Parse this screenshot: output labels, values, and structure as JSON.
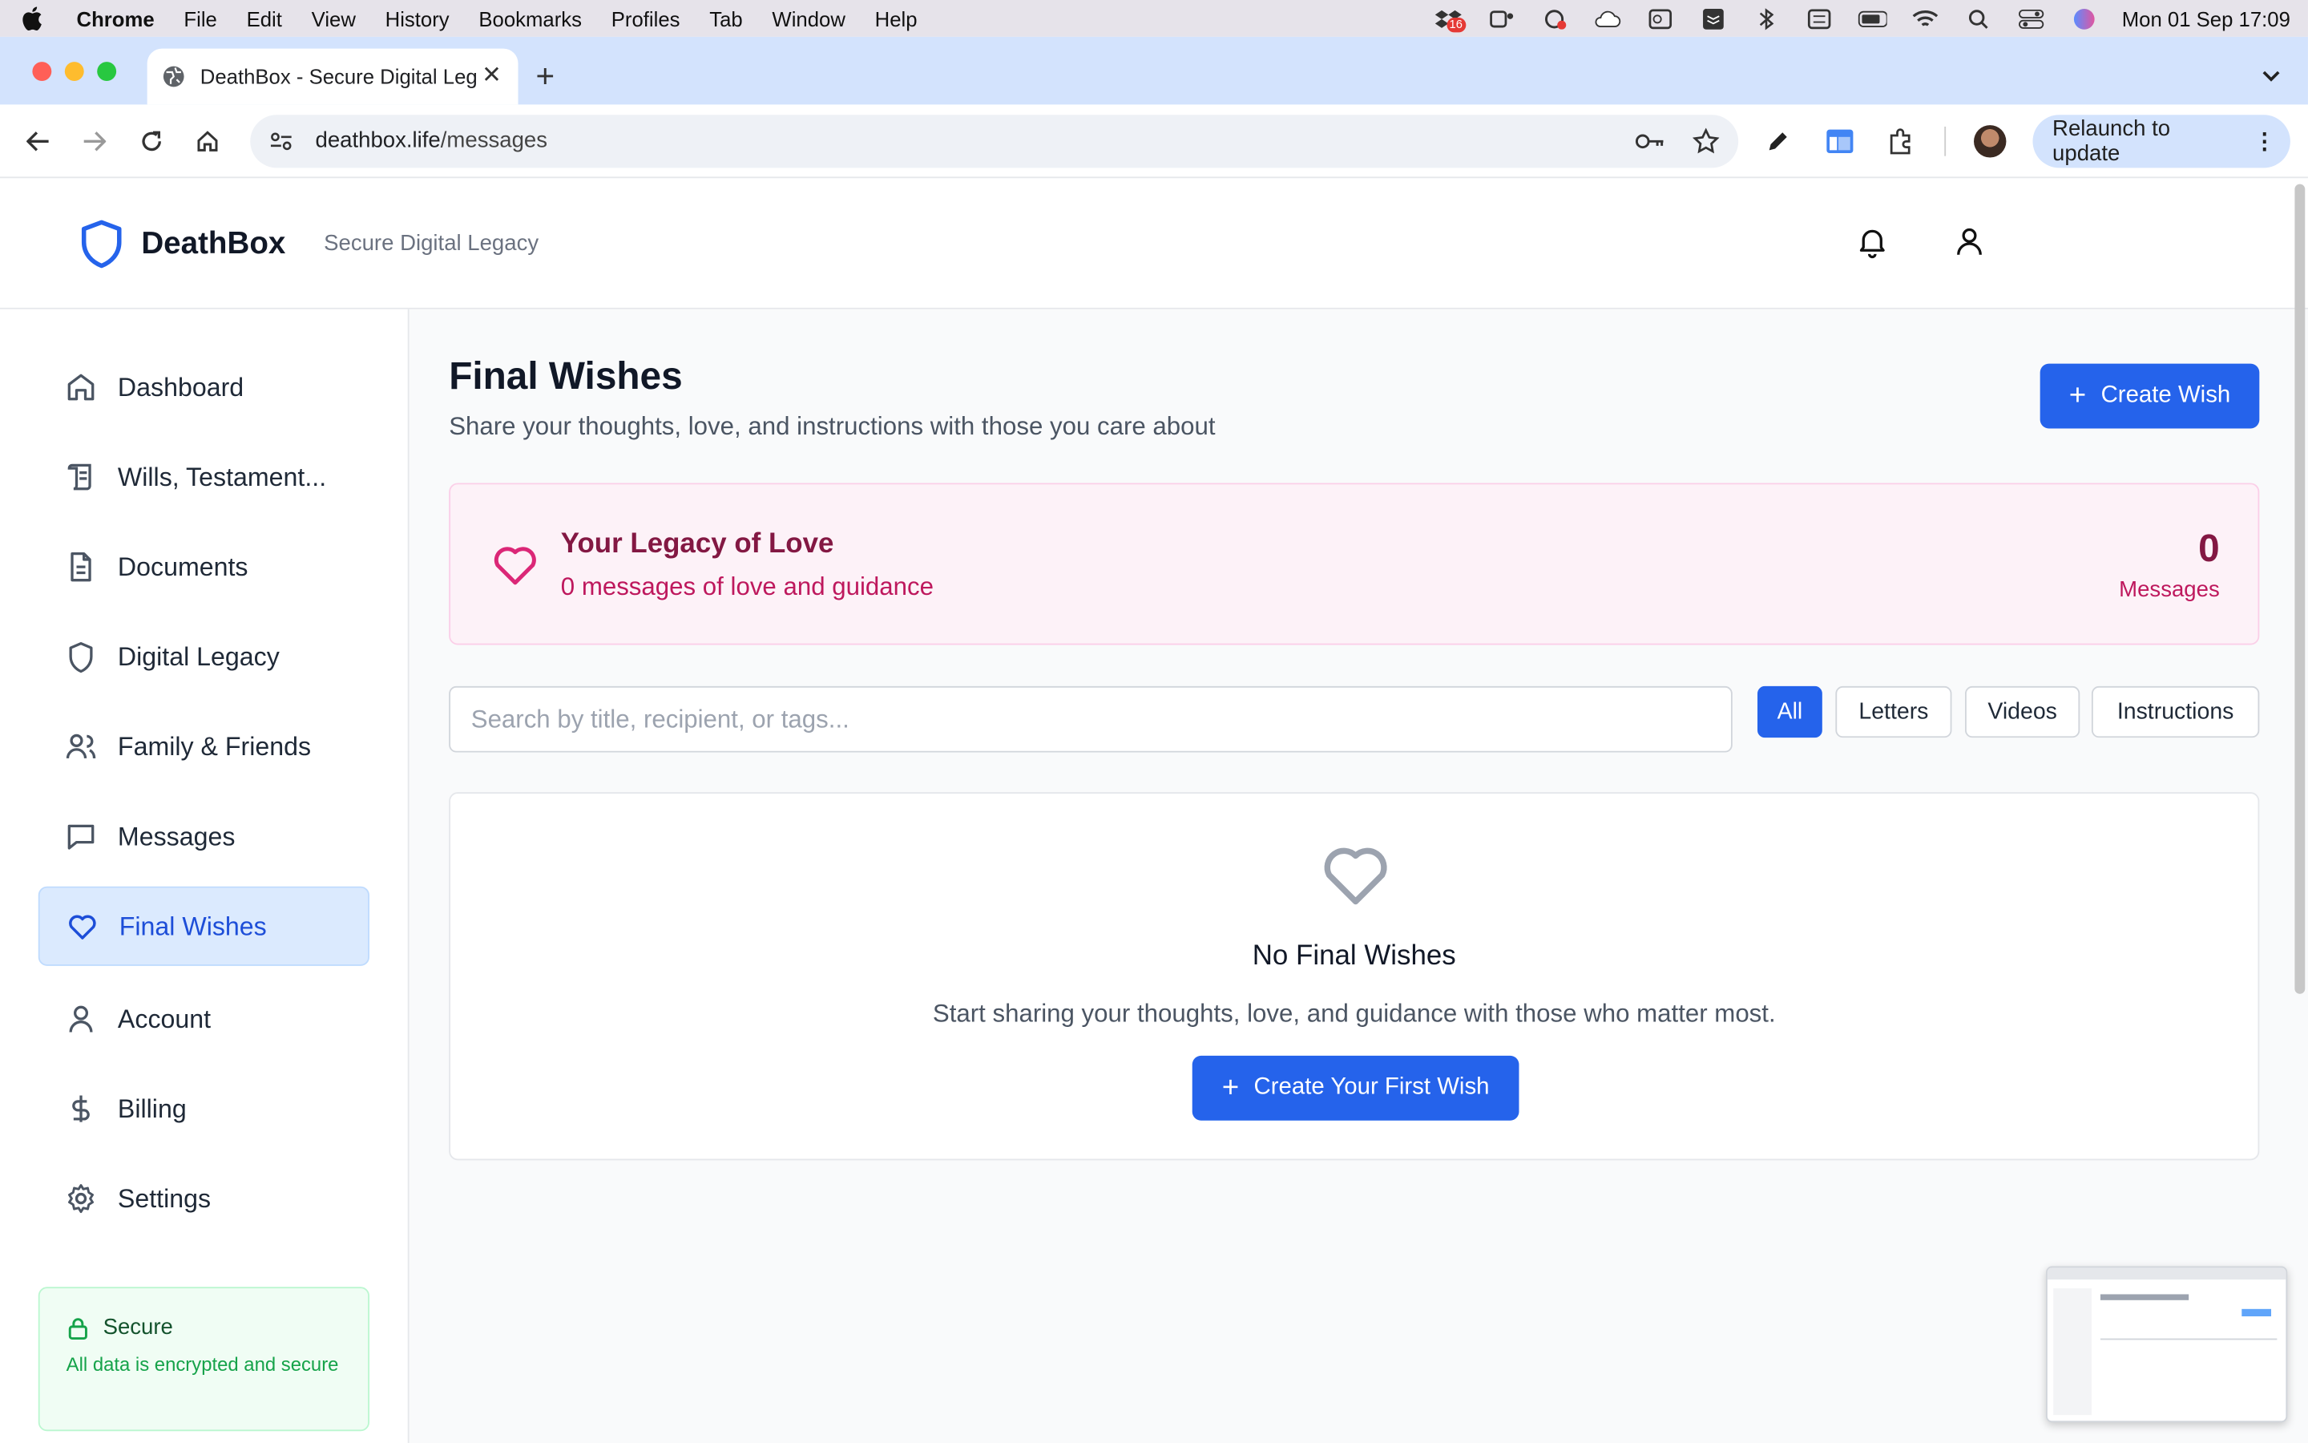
{
  "menubar": {
    "app": "Chrome",
    "items": [
      "File",
      "Edit",
      "View",
      "History",
      "Bookmarks",
      "Profiles",
      "Tab",
      "Window",
      "Help"
    ],
    "datetime": "Mon 01 Sep  17:09",
    "badge": "16"
  },
  "browser": {
    "tab_title": "DeathBox - Secure Digital Leg",
    "url_host": "deathbox.life",
    "url_path": "/messages",
    "relaunch_label": "Relaunch to update"
  },
  "header": {
    "brand": "DeathBox",
    "tagline": "Secure Digital Legacy"
  },
  "sidebar": {
    "items": [
      {
        "label": "Dashboard",
        "icon": "home-icon"
      },
      {
        "label": "Wills, Testament...",
        "icon": "scroll-icon"
      },
      {
        "label": "Documents",
        "icon": "file-icon"
      },
      {
        "label": "Digital Legacy",
        "icon": "shield-icon"
      },
      {
        "label": "Family & Friends",
        "icon": "users-icon"
      },
      {
        "label": "Messages",
        "icon": "message-icon"
      },
      {
        "label": "Final Wishes",
        "icon": "heart-icon"
      },
      {
        "label": "Account",
        "icon": "user-icon"
      },
      {
        "label": "Billing",
        "icon": "dollar-icon"
      },
      {
        "label": "Settings",
        "icon": "gear-icon"
      }
    ],
    "active": "Final Wishes",
    "secure_title": "Secure",
    "secure_text": "All data is encrypted and secure"
  },
  "main": {
    "title": "Final Wishes",
    "subtitle": "Share your thoughts, love, and instructions with those you care about",
    "create_label": "Create Wish",
    "legacy": {
      "title": "Your Legacy of Love",
      "subtitle": "0 messages of love and guidance",
      "count": "0",
      "count_label": "Messages"
    },
    "search_placeholder": "Search by title, recipient, or tags...",
    "filters": [
      "All",
      "Letters",
      "Videos",
      "Instructions"
    ],
    "active_filter": "All",
    "empty": {
      "title": "No Final Wishes",
      "subtitle": "Start sharing your thoughts, love, and guidance with those who matter most.",
      "button": "Create Your First Wish"
    }
  },
  "colors": {
    "primary": "#2563eb",
    "pink_bg": "#fdf2f8",
    "pink_text": "#831843",
    "green_bg": "#f0fdf4"
  }
}
